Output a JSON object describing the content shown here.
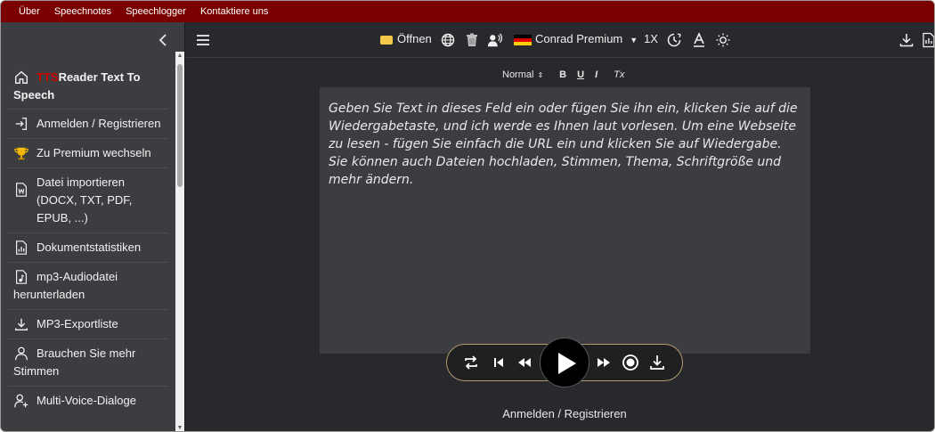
{
  "topnav": {
    "items": [
      "Über",
      "Speechnotes",
      "Speechlogger",
      "Kontaktiere uns"
    ]
  },
  "sidebar": {
    "collapse_icon": "chevron-left-icon",
    "home": {
      "brand": "TTS",
      "label": "Reader Text To Speech",
      "icon": "home-icon"
    },
    "items": [
      {
        "label": "Anmelden / Registrieren",
        "icon": "login-icon"
      },
      {
        "label": "Zu Premium wechseln",
        "icon": "trophy-icon"
      },
      {
        "label": "Datei importieren (DOCX, TXT, PDF, EPUB, ...)",
        "icon": "word-file-icon"
      },
      {
        "label": "Dokumentstatistiken",
        "icon": "stats-file-icon"
      },
      {
        "label": "mp3-Audiodatei herunterladen",
        "icon": "audio-file-icon"
      },
      {
        "label": "MP3-Exportliste",
        "icon": "download-icon"
      },
      {
        "label": "Brauchen Sie mehr Stimmen",
        "icon": "person-icon"
      },
      {
        "label": "Multi-Voice-Dialoge",
        "icon": "add-person-icon"
      }
    ]
  },
  "toolbar": {
    "open_label": "Öffnen",
    "voice_label": "Conrad Premium",
    "speed_label": "1X",
    "icons": [
      "menu-icon",
      "folder-icon",
      "globe-icon",
      "trash-icon",
      "voice-icon",
      "german-flag-icon",
      "timer-icon",
      "font-size-icon",
      "brightness-icon",
      "download-icon",
      "pdf-icon"
    ]
  },
  "format_bar": {
    "style_label": "Normal",
    "bold": "B",
    "underline": "U",
    "italic": "I",
    "clear": "Tx"
  },
  "editor": {
    "text": "Geben Sie Text in dieses Feld ein oder fügen Sie ihn ein, klicken Sie auf die Wiedergabetaste, und ich werde es Ihnen laut vorlesen. Um eine Webseite zu lesen - fügen Sie einfach die URL ein und klicken Sie auf Wiedergabe. Sie können auch Dateien hochladen, Stimmen, Thema, Schriftgröße und mehr ändern."
  },
  "player": {
    "icons": [
      "repeat-icon",
      "skip-start-icon",
      "rewind-icon",
      "play-icon",
      "fast-forward-icon",
      "record-icon",
      "download-icon"
    ]
  },
  "footer": {
    "login_label": "Anmelden / Registrieren"
  },
  "colors": {
    "topnav_bg": "#7a0000",
    "sidebar_bg": "#3b3d41",
    "main_bg": "#27292c",
    "editor_bg": "#3b3d41",
    "brand_red": "#d10000",
    "player_border": "#b39a6d"
  }
}
